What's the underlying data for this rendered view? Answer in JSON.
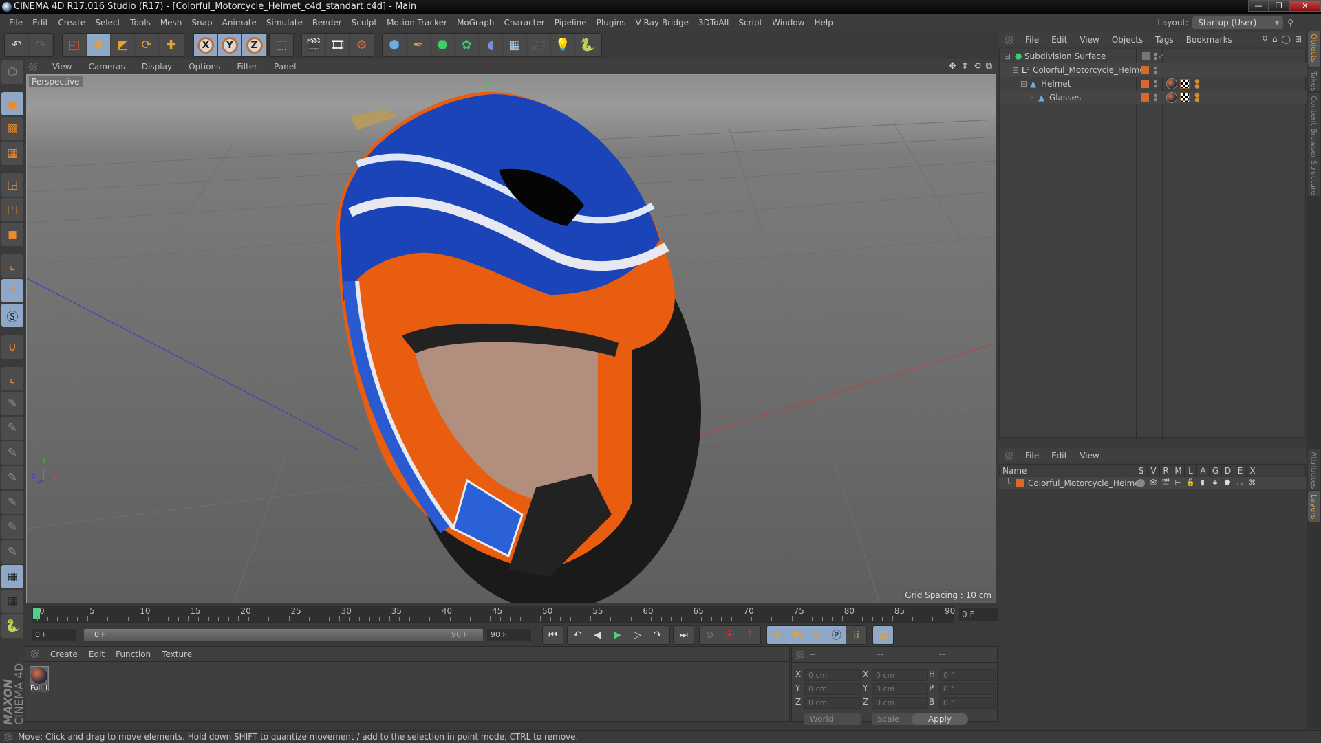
{
  "window": {
    "title": "CINEMA 4D R17.016 Studio (R17) - [Colorful_Motorcycle_Helmet_c4d_standart.c4d] - Main",
    "controls": [
      "minimize",
      "restore",
      "close"
    ]
  },
  "menubar": {
    "items": [
      "File",
      "Edit",
      "Create",
      "Select",
      "Tools",
      "Mesh",
      "Snap",
      "Animate",
      "Simulate",
      "Render",
      "Sculpt",
      "Motion Tracker",
      "MoGraph",
      "Character",
      "Pipeline",
      "Plugins",
      "V-Ray Bridge",
      "3DToAll",
      "Script",
      "Window",
      "Help"
    ],
    "layout_label": "Layout:",
    "layout_value": "Startup (User)"
  },
  "toolbar": {
    "history": [
      "undo-icon",
      "redo-icon"
    ],
    "tools": [
      "live-selection-icon",
      "move-icon",
      "scale-icon",
      "rotate-icon",
      "last-tool-icon"
    ],
    "axes": [
      "X",
      "Y",
      "Z"
    ],
    "coord_system": "world-coordinates-icon",
    "render": [
      "render-view-icon",
      "render-picture-viewer-icon",
      "render-settings-icon"
    ],
    "create": [
      "cube-icon",
      "pen-icon",
      "subdivision-surface-icon",
      "mograph-cloner-icon",
      "deformer-icon",
      "floor-icon",
      "camera-icon",
      "light-icon",
      "python-icon"
    ]
  },
  "left_tools": [
    "make-editable-icon",
    "model-mode-icon",
    "texture-mode-icon",
    "workplane-icon",
    "points-mode-icon",
    "edges-mode-icon",
    "polygons-mode-icon",
    "axis-mode-icon",
    "tweak-mode-icon",
    "solo-icon",
    "snap-icon",
    "workplane-axis-icon",
    "brush-icon",
    "brush-p-icon",
    "brush-r-icon",
    "brush-psr-icon",
    "brush-target-icon",
    "brush-lock-icon",
    "brush-hand-icon",
    "workplane-lock-icon",
    "grid-rotate-icon",
    "python-icon"
  ],
  "viewport": {
    "menu": [
      "View",
      "Cameras",
      "Display",
      "Options",
      "Filter",
      "Panel"
    ],
    "camera_label": "Perspective",
    "grid_spacing": "Grid Spacing : 10 cm",
    "axis_labels": [
      "Y",
      "Z",
      "X"
    ]
  },
  "timeline": {
    "ticks": [
      "0",
      "5",
      "10",
      "15",
      "20",
      "25",
      "30",
      "35",
      "40",
      "45",
      "50",
      "55",
      "60",
      "65",
      "70",
      "75",
      "80",
      "85",
      "90"
    ],
    "current_frame": "0 F",
    "start_field": "0 F",
    "range_start": "0 F",
    "range_end": "90 F",
    "end_field": "90 F"
  },
  "material_manager": {
    "menu": [
      "Create",
      "Edit",
      "Function",
      "Texture"
    ],
    "materials": [
      {
        "name": "Full_l"
      }
    ]
  },
  "coordinates": {
    "headers": [
      "--",
      "--",
      "--"
    ],
    "position": [
      {
        "axis": "X",
        "value": "0 cm"
      },
      {
        "axis": "Y",
        "value": "0 cm"
      },
      {
        "axis": "Z",
        "value": "0 cm"
      }
    ],
    "size": [
      {
        "axis": "X",
        "value": "0 cm"
      },
      {
        "axis": "Y",
        "value": "0 cm"
      },
      {
        "axis": "Z",
        "value": "0 cm"
      }
    ],
    "rotation": [
      {
        "axis": "H",
        "value": "0 °"
      },
      {
        "axis": "P",
        "value": "0 °"
      },
      {
        "axis": "B",
        "value": "0 °"
      }
    ],
    "mode_dropdown": "World",
    "type_dropdown": "Scale",
    "apply_label": "Apply"
  },
  "object_manager": {
    "menu": [
      "File",
      "Edit",
      "View",
      "Objects",
      "Tags",
      "Bookmarks"
    ],
    "objects": [
      {
        "name": "Subdivision Surface",
        "icon": "subdivision-surface-icon",
        "depth": 0,
        "tags": []
      },
      {
        "name": "Colorful_Motorcycle_Helmet",
        "icon": "null-object-icon",
        "depth": 1,
        "tags": []
      },
      {
        "name": "Helmet",
        "icon": "polygon-object-icon",
        "depth": 2,
        "tags": [
          "material-tag",
          "uvw-tag",
          "selection-tag"
        ]
      },
      {
        "name": "Glasses",
        "icon": "polygon-object-icon",
        "depth": 3,
        "tags": [
          "material-tag",
          "uvw-tag",
          "selection-tag"
        ]
      }
    ]
  },
  "layer_manager": {
    "menu": [
      "File",
      "Edit",
      "View"
    ],
    "columns": [
      "Name",
      "S",
      "V",
      "R",
      "M",
      "L",
      "A",
      "G",
      "D",
      "E",
      "X"
    ],
    "layers": [
      {
        "name": "Colorful_Motorcycle_Helmet",
        "color": "#d9692a"
      }
    ]
  },
  "side_tabs": {
    "top": [
      "Objects",
      "Takes",
      "Content Browser",
      "Structure"
    ],
    "bottom": [
      "Attributes",
      "Layers"
    ]
  },
  "status": "Move: Click and drag to move elements. Hold down SHIFT to quantize movement / add to the selection in point mode, CTRL to remove.",
  "branding": {
    "maxon": "MAXON",
    "product": "CINEMA 4D"
  },
  "colors": {
    "accent": "#e8a030",
    "active_tool": "#8fa8c8",
    "layer_color": "#d9692a",
    "playhead": "#4fd18a"
  }
}
